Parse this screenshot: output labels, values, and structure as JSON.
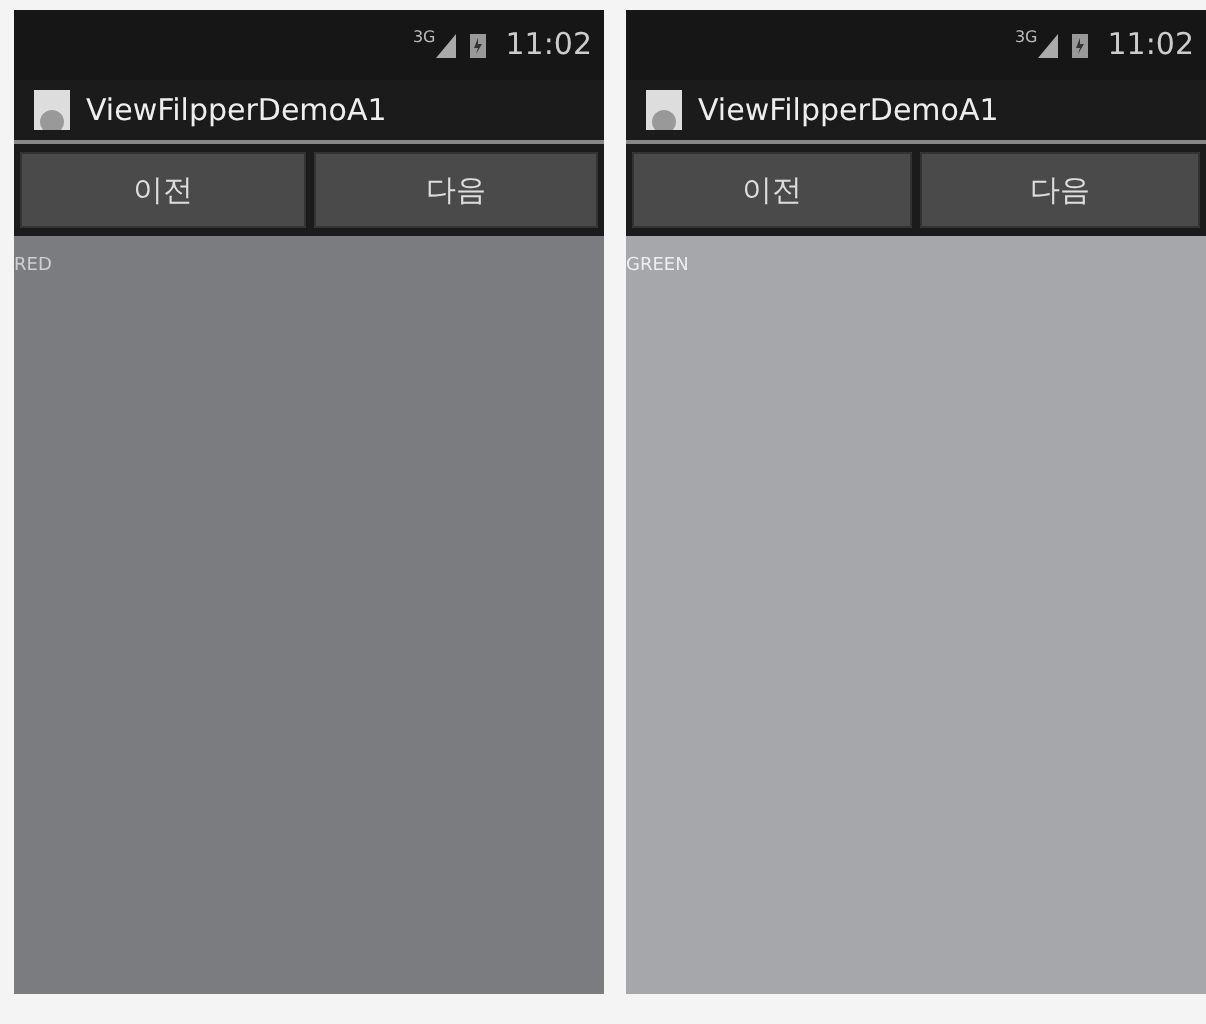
{
  "screens": [
    {
      "status_bar": {
        "network": "3G",
        "time": "11:02"
      },
      "title": "ViewFilpperDemoA1",
      "buttons": [
        "이전",
        "다음"
      ],
      "page_label": "RED",
      "color": "#7b7c80"
    },
    {
      "status_bar": {
        "network": "3G",
        "time": "11:02"
      },
      "title": "ViewFilpperDemoA1",
      "buttons": [
        "이전",
        "다음"
      ],
      "page_label": "GREEN",
      "color": "#a6a7aa"
    }
  ]
}
